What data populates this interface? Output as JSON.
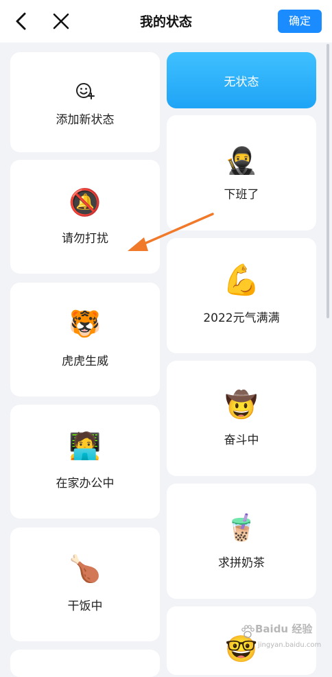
{
  "header": {
    "title": "我的状态",
    "confirm_label": "确定",
    "back_icon": "chevron-left-icon",
    "close_icon": "close-icon"
  },
  "colors": {
    "accent": "#1a8cff",
    "selected_gradient_top": "#3fc0ff",
    "selected_gradient_bottom": "#1fa4f6",
    "annotation_arrow": "#f07a2a",
    "background": "#f2f3f7"
  },
  "left_column": [
    {
      "label": "添加新状态",
      "icon": "smile-plus-icon",
      "glyph": ""
    },
    {
      "label": "请勿打扰",
      "icon": "no-bell-icon",
      "glyph": "🔕"
    },
    {
      "label": "虎虎生威",
      "icon": "tiger-icon",
      "glyph": "🐯"
    },
    {
      "label": "在家办公中",
      "icon": "laptop-person-icon",
      "glyph": "🧑‍💻"
    },
    {
      "label": "干饭中",
      "icon": "drumstick-icon",
      "glyph": "🍗"
    }
  ],
  "right_column": [
    {
      "label": "无状态",
      "icon": "",
      "glyph": "",
      "selected": true
    },
    {
      "label": "下班了",
      "icon": "ninja-icon",
      "glyph": "🥷"
    },
    {
      "label": "2022元气满满",
      "icon": "flexed-biceps-icon",
      "glyph": "💪"
    },
    {
      "label": "奋斗中",
      "icon": "headband-face-icon",
      "glyph": "🤠"
    },
    {
      "label": "求拼奶茶",
      "icon": "bubble-tea-icon",
      "glyph": "🧋"
    },
    {
      "label": "",
      "icon": "nerd-face-icon",
      "glyph": "🤓"
    }
  ],
  "watermark": {
    "main": "Baidu 经验",
    "sub": "jingyan.baidu.com"
  }
}
